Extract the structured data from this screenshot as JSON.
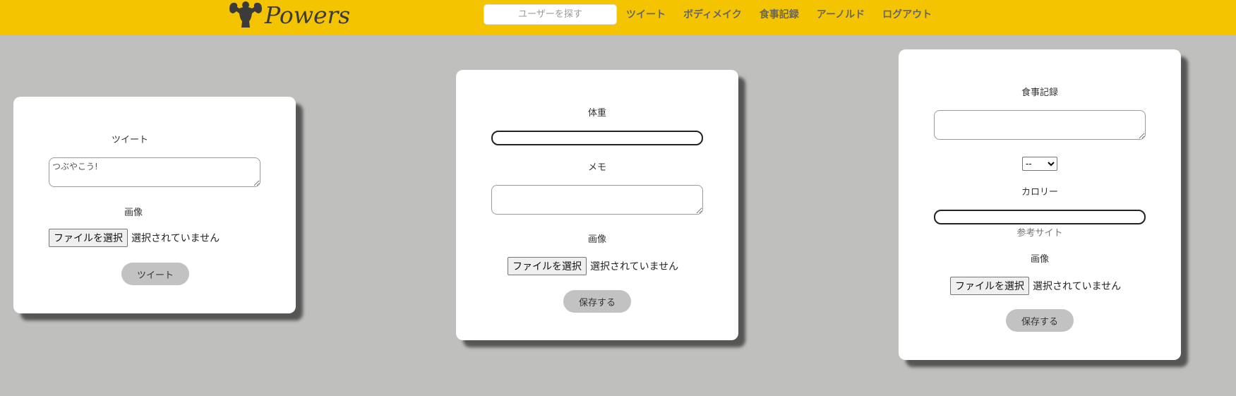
{
  "header": {
    "logo_text": "Powers",
    "logo_icon": "muscle-figure-icon",
    "search_placeholder": "ユーザーを探す",
    "nav": [
      "ツイート",
      "ボディメイク",
      "食事記録",
      "アーノルド",
      "ログアウト"
    ],
    "background": "#f5c400"
  },
  "tweet_form": {
    "title": "ツイート",
    "textarea_placeholder": "つぶやこう!",
    "image_label": "画像",
    "file_button": "ファイルを選択",
    "file_status": "選択されていません",
    "submit": "ツイート"
  },
  "body_form": {
    "weight_label": "体重",
    "memo_label": "メモ",
    "image_label": "画像",
    "file_button": "ファイルを選択",
    "file_status": "選択されていません",
    "submit": "保存する"
  },
  "meal_form": {
    "title": "食事記録",
    "select_value": "--",
    "calorie_label": "カロリー",
    "reference_link": "参考サイト",
    "image_label": "画像",
    "file_button": "ファイルを選択",
    "file_status": "選択されていません",
    "submit": "保存する"
  }
}
